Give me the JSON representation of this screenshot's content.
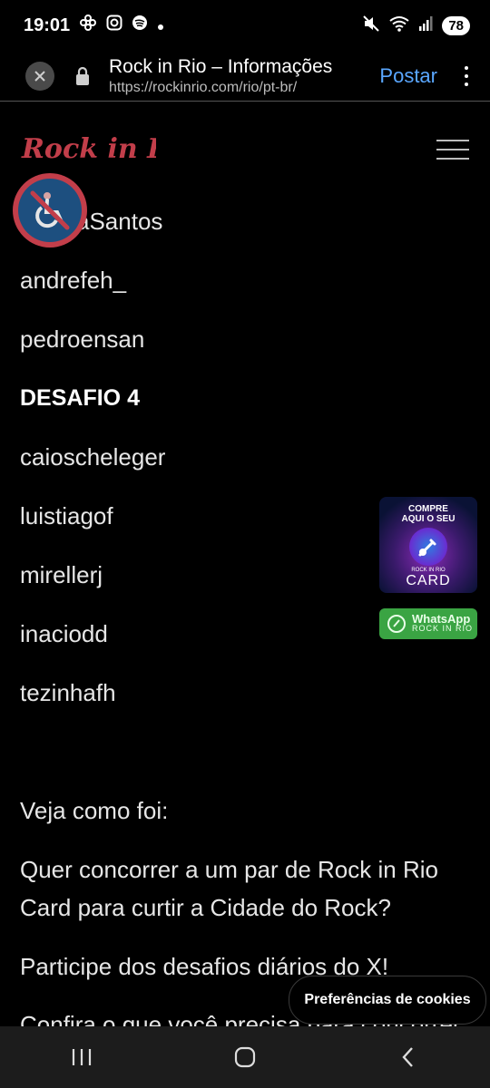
{
  "status_bar": {
    "time": "19:01",
    "battery": "78",
    "icons": [
      "flower-icon",
      "instagram-icon",
      "spotify-icon",
      "dot-icon",
      "mute-icon",
      "wifi-icon",
      "signal-icon"
    ]
  },
  "browser": {
    "page_title": "Rock in Rio – Informações",
    "url": "https://rockinrio.com/rio/pt-br/",
    "post_label": "Postar"
  },
  "site": {
    "logo_text": "Rock in Rio"
  },
  "winners": {
    "items": [
      {
        "text": "aSantos",
        "bold": false
      },
      {
        "text": "andrefeh_",
        "bold": false
      },
      {
        "text": "pedroensan",
        "bold": false
      },
      {
        "text": "DESAFIO 4",
        "bold": true
      },
      {
        "text": "caioscheleger",
        "bold": false
      },
      {
        "text": "luistiagof",
        "bold": false
      },
      {
        "text": "mirellerj",
        "bold": false
      },
      {
        "text": "inaciodd",
        "bold": false
      },
      {
        "text": "tezinhafh",
        "bold": false
      }
    ]
  },
  "article": {
    "see_how": "Veja como foi:",
    "question": "Quer concorrer a um par de Rock in Rio Card para curtir a Cidade do Rock?",
    "challenge": "Participe dos desafios diários do X!",
    "confira": "Confira o que você precisa para concorrer"
  },
  "promo": {
    "line1": "COMPRE",
    "line2": "AQUI O SEU",
    "small": "ROCK IN RIO",
    "card": "CARD"
  },
  "whatsapp": {
    "title": "WhatsApp",
    "subtitle": "ROCK IN RIO"
  },
  "cookie_label": "Preferências de cookies",
  "colors": {
    "brand_red": "#c23e4a",
    "link_blue": "#5aa7ff",
    "whatsapp_green": "#3aa443"
  }
}
